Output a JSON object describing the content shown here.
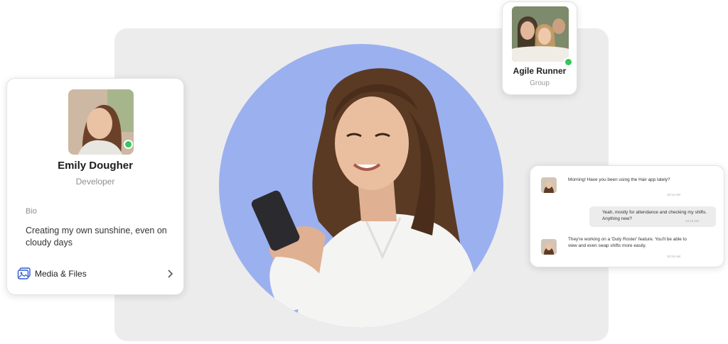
{
  "profile_card": {
    "name": "Emily Dougher",
    "role": "Developer",
    "bio_label": "Bio",
    "bio_text": "Creating my own sunshine, even on cloudy days",
    "media_label": "Media & Files",
    "online": true
  },
  "group_card": {
    "name": "Agile Runner",
    "type": "Group",
    "online": true
  },
  "chat_card": {
    "messages": [
      {
        "direction": "incoming",
        "text": "Morning! Have you been using the Hair app lately?",
        "time": "10:14 AM"
      },
      {
        "direction": "outgoing",
        "text": "Yeah, mostly for attendance and checking my shifts. Anything new?",
        "time": "10:15 AM"
      },
      {
        "direction": "incoming",
        "text": "They're working on a 'Duty Roster' feature. You'll be able to view and even swap shifts more easily.",
        "time": "10:16 AM"
      }
    ]
  },
  "colors": {
    "hero_circle": "#9bb0ef",
    "backdrop": "#ececec",
    "online_dot": "#34c759",
    "media_icon": "#2f5bd3"
  },
  "icons": {
    "media": "media-files-icon",
    "chevron": "chevron-right-icon"
  }
}
